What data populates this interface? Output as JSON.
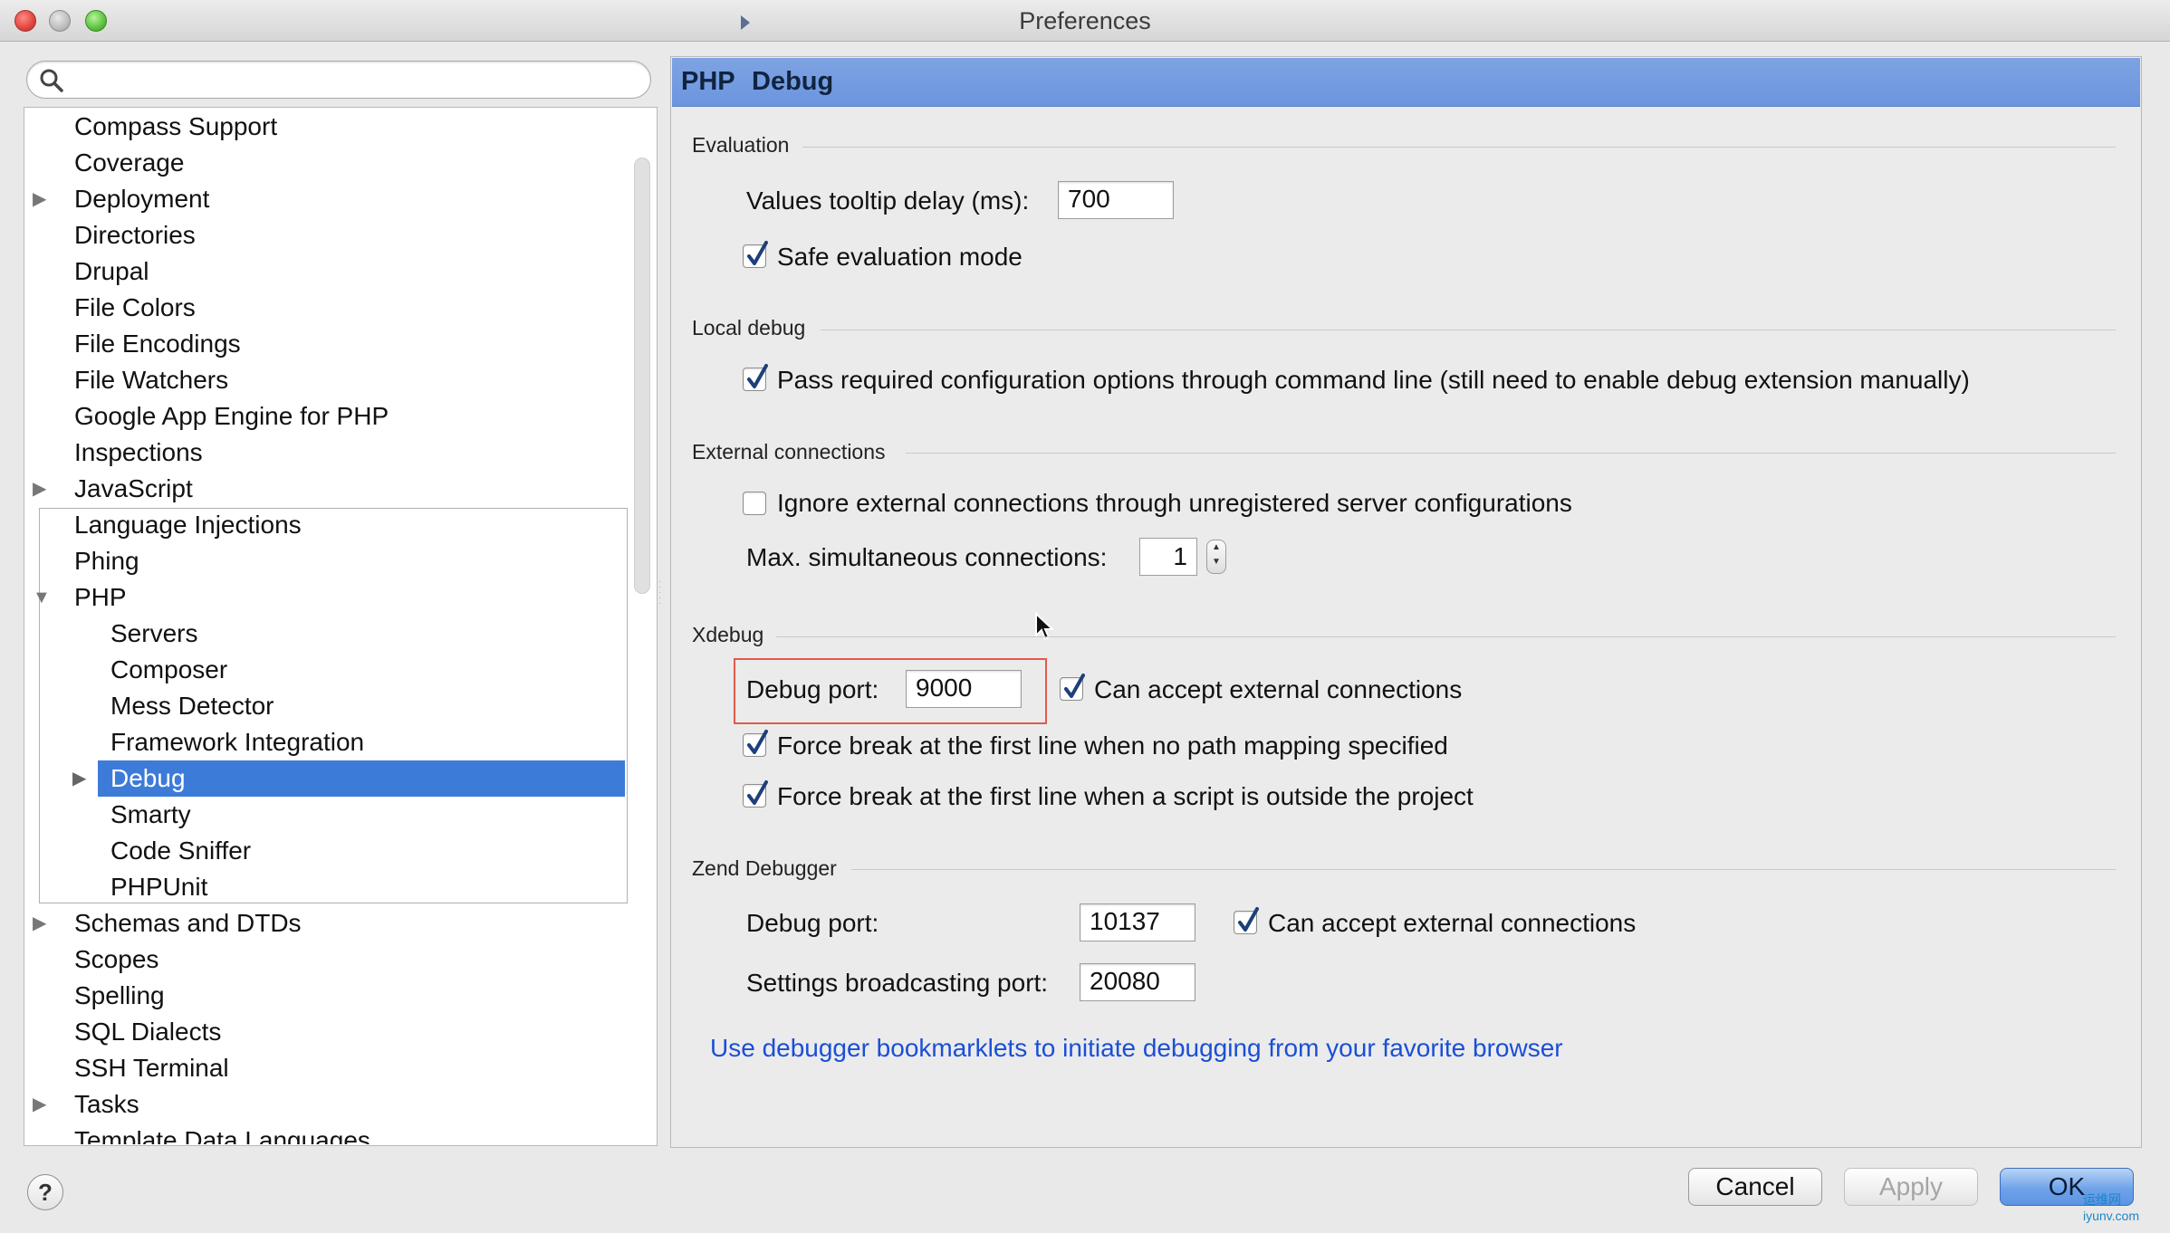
{
  "window": {
    "title": "Preferences"
  },
  "search": {
    "placeholder": ""
  },
  "sidebar": {
    "items": [
      {
        "label": "Compass Support",
        "expandable": false
      },
      {
        "label": "Coverage",
        "expandable": false
      },
      {
        "label": "Deployment",
        "expandable": true
      },
      {
        "label": "Directories",
        "expandable": false
      },
      {
        "label": "Drupal",
        "expandable": false
      },
      {
        "label": "File Colors",
        "expandable": false
      },
      {
        "label": "File Encodings",
        "expandable": false
      },
      {
        "label": "File Watchers",
        "expandable": false
      },
      {
        "label": "Google App Engine for PHP",
        "expandable": false
      },
      {
        "label": "Inspections",
        "expandable": false
      },
      {
        "label": "JavaScript",
        "expandable": true
      },
      {
        "label": "Language Injections",
        "expandable": false
      },
      {
        "label": "Phing",
        "expandable": false
      },
      {
        "label": "PHP",
        "expandable": true,
        "expanded": true
      }
    ],
    "php_children": [
      {
        "label": "Servers"
      },
      {
        "label": "Composer"
      },
      {
        "label": "Mess Detector"
      },
      {
        "label": "Framework Integration"
      },
      {
        "label": "Debug",
        "selected": true,
        "expandable": true
      },
      {
        "label": "Smarty"
      },
      {
        "label": "Code Sniffer"
      },
      {
        "label": "PHPUnit"
      }
    ],
    "after_items": [
      {
        "label": "Schemas and DTDs",
        "expandable": true
      },
      {
        "label": "Scopes"
      },
      {
        "label": "Spelling"
      },
      {
        "label": "SQL Dialects"
      },
      {
        "label": "SSH Terminal"
      },
      {
        "label": "Tasks",
        "expandable": true
      },
      {
        "label": "Template Data Languages"
      }
    ]
  },
  "header": {
    "crumb_parent": "PHP",
    "crumb_current": "Debug"
  },
  "evaluation": {
    "title": "Evaluation",
    "tooltip_delay_label": "Values tooltip delay (ms):",
    "tooltip_delay_value": "700",
    "safe_mode_label": "Safe evaluation mode",
    "safe_mode_checked": true
  },
  "local_debug": {
    "title": "Local debug",
    "pass_options_label": "Pass required configuration options through command line (still need to enable debug extension manually)",
    "pass_options_checked": true
  },
  "external": {
    "title": "External connections",
    "ignore_label": "Ignore external connections through unregistered server configurations",
    "ignore_checked": false,
    "max_label": "Max. simultaneous connections:",
    "max_value": "1"
  },
  "xdebug": {
    "title": "Xdebug",
    "port_label": "Debug port:",
    "port_value": "9000",
    "accept_label": "Can accept external connections",
    "accept_checked": true,
    "force_no_mapping_label": "Force break at the first line when no path mapping specified",
    "force_no_mapping_checked": true,
    "force_outside_label": "Force break at the first line when a script is outside the project",
    "force_outside_checked": true
  },
  "zend": {
    "title": "Zend Debugger",
    "port_label": "Debug port:",
    "port_value": "10137",
    "accept_label": "Can accept external connections",
    "accept_checked": true,
    "broadcast_label": "Settings broadcasting port:",
    "broadcast_value": "20080"
  },
  "bookmarklets_link": "Use debugger bookmarklets to initiate debugging from your favorite browser",
  "footer": {
    "help_label": "?",
    "cancel_label": "Cancel",
    "apply_label": "Apply",
    "ok_label": "OK"
  },
  "watermark": {
    "cn": "运维网",
    "url": "iyunv.com"
  },
  "colors": {
    "selection": "#3d7bd9",
    "header": "#7ea3e3",
    "link": "#1a4fd6",
    "highlight": "#e05a4e"
  }
}
